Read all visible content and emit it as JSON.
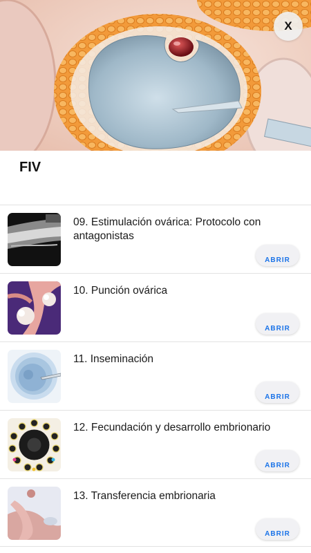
{
  "header": {
    "close_label": "X",
    "title": "FIV"
  },
  "items": [
    {
      "title": "09. Estimulación ovárica: Protocolo con antagonistas",
      "button": "ABRIR",
      "thumb_icon": "ultrasound-thumbnail"
    },
    {
      "title": "10. Punción ovárica",
      "button": "ABRIR",
      "thumb_icon": "ovary-thumbnail"
    },
    {
      "title": "11. Inseminación",
      "button": "ABRIR",
      "thumb_icon": "injection-thumbnail"
    },
    {
      "title": "12. Fecundación y desarrollo embrionario",
      "button": "ABRIR",
      "thumb_icon": "embryo-development-thumbnail"
    },
    {
      "title": "13. Transferencia embrionaria",
      "button": "ABRIR",
      "thumb_icon": "uterus-thumbnail"
    }
  ],
  "colors": {
    "accent": "#1a73e8",
    "divider": "#e2e2e2",
    "button_bg": "#f1f1f4"
  }
}
